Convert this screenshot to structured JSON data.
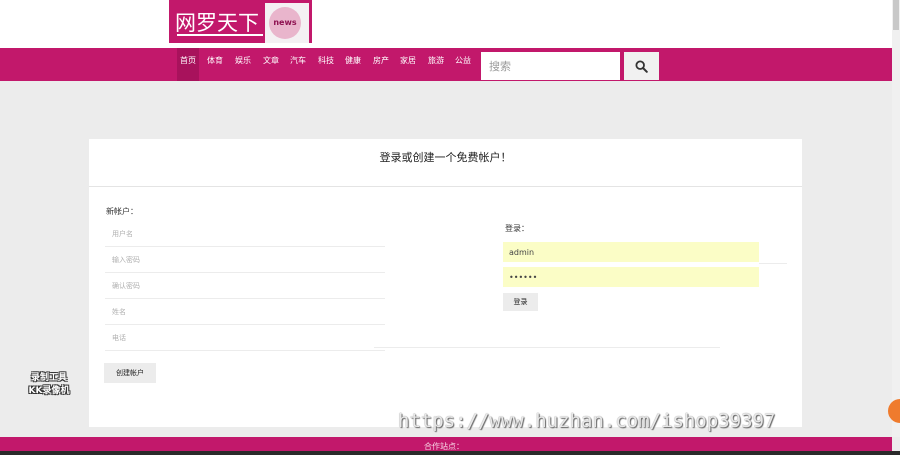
{
  "header": {
    "logo_text": "网罗天下",
    "logo_badge": "news"
  },
  "nav": {
    "items": [
      "首页",
      "体育",
      "娱乐",
      "文章",
      "汽车",
      "科技",
      "健康",
      "房产",
      "家居",
      "旅游",
      "公益"
    ],
    "search_placeholder": "搜索",
    "search_icon": "search-icon"
  },
  "main": {
    "title": "登录或创建一个免费帐户！",
    "register": {
      "label": "新帐户：",
      "fields": [
        {
          "placeholder": "用户名"
        },
        {
          "placeholder": "输入密码"
        },
        {
          "placeholder": "确认密码"
        },
        {
          "placeholder": "姓名"
        },
        {
          "placeholder": "电话"
        }
      ],
      "submit_label": "创建帐户"
    },
    "login": {
      "label": "登录：",
      "username_value": "admin",
      "password_value": "••••••",
      "submit_label": "登录"
    }
  },
  "footer": {
    "partner_label": "合作站点："
  },
  "overlay": {
    "watermark": "https://www.huzhan.com/ishop39397",
    "recorder_line1": "录制工具",
    "recorder_line2": "KK录像机"
  },
  "colors": {
    "brand": "#c2186b",
    "autofill": "#fbfdc6"
  }
}
